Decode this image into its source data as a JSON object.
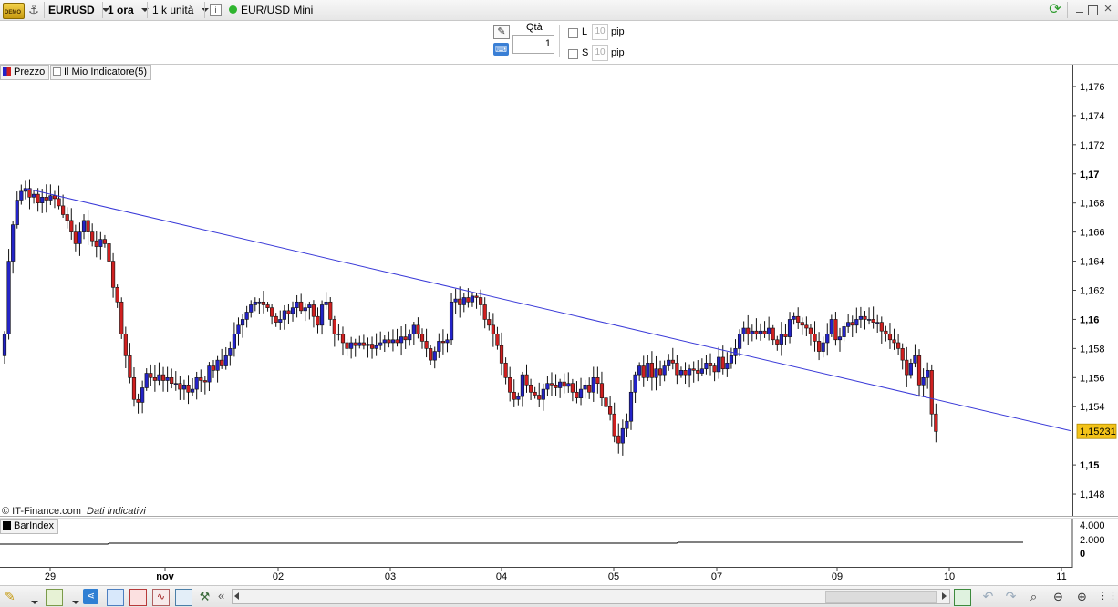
{
  "toolbar": {
    "demo_badge": "DEMO",
    "symbol": "EURUSD",
    "timeframe": "1 ora",
    "units": "1 k unità",
    "instrument_name": "EUR/USD Mini",
    "status_color": "#2fb52f"
  },
  "order_panel": {
    "qty_label": "Qtà",
    "qty_value": "1",
    "limit_label": "L",
    "limit_value": "10",
    "limit_unit": "pip",
    "stop_label": "S",
    "stop_value": "10",
    "stop_unit": "pip"
  },
  "legend": {
    "price_label": "Prezzo",
    "indicator_label": "Il Mio Indicatore(5)"
  },
  "copyright": {
    "source": "© IT-Finance.com",
    "note": "Dati indicativi"
  },
  "subpanel": {
    "label": "BarIndex",
    "ticks": [
      "4.000",
      "2.000",
      "0"
    ]
  },
  "chart_data": {
    "type": "candlestick",
    "instrument": "EURUSD",
    "timeframe": "1 ora",
    "y_ticks": [
      "1,176",
      "1,174",
      "1,172",
      "1,17",
      "1,168",
      "1,166",
      "1,164",
      "1,162",
      "1,16",
      "1,158",
      "1,156",
      "1,154",
      "1,15",
      "1,148"
    ],
    "ylim": [
      1.1465,
      1.1775
    ],
    "x_ticks": [
      "29",
      "nov",
      "02",
      "03",
      "04",
      "05",
      "07",
      "09",
      "10",
      "11"
    ],
    "current_price_label": "1,15231",
    "current_price": 1.15231,
    "trendline": {
      "from": 1.169,
      "to": 1.1531
    },
    "colors": {
      "up": "#2323c8",
      "down": "#d02020",
      "trendline": "#3a3ad8",
      "price_tag": "#f3c319"
    },
    "closes": [
      1.159,
      1.164,
      1.1665,
      1.1682,
      1.1688,
      1.169,
      1.1684,
      1.1686,
      1.168,
      1.1684,
      1.1682,
      1.1685,
      1.1683,
      1.1678,
      1.1672,
      1.1668,
      1.166,
      1.1652,
      1.166,
      1.1668,
      1.166,
      1.1654,
      1.165,
      1.1655,
      1.1652,
      1.164,
      1.1622,
      1.1612,
      1.159,
      1.1575,
      1.156,
      1.1545,
      1.1543,
      1.1553,
      1.1563,
      1.156,
      1.1558,
      1.1562,
      1.1558,
      1.156,
      1.1556,
      1.1556,
      1.1552,
      1.1555,
      1.155,
      1.1552,
      1.156,
      1.1558,
      1.1557,
      1.1568,
      1.1565,
      1.1572,
      1.1568,
      1.1575,
      1.158,
      1.159,
      1.1596,
      1.16,
      1.1605,
      1.161,
      1.1612,
      1.1612,
      1.161,
      1.1608,
      1.1602,
      1.1598,
      1.16,
      1.1606,
      1.1604,
      1.1608,
      1.1612,
      1.1606,
      1.1608,
      1.161,
      1.1602,
      1.1596,
      1.161,
      1.1612,
      1.16,
      1.159,
      1.159,
      1.1584,
      1.158,
      1.1584,
      1.1582,
      1.1584,
      1.1582,
      1.1583,
      1.158,
      1.1582,
      1.1584,
      1.1586,
      1.1584,
      1.1586,
      1.1584,
      1.1588,
      1.1586,
      1.159,
      1.1596,
      1.159,
      1.1585,
      1.158,
      1.1572,
      1.1578,
      1.1585,
      1.1584,
      1.1586,
      1.1612,
      1.1614,
      1.161,
      1.1615,
      1.1612,
      1.1616,
      1.1615,
      1.161,
      1.16,
      1.1596,
      1.159,
      1.1582,
      1.157,
      1.156,
      1.155,
      1.1545,
      1.1547,
      1.1562,
      1.1555,
      1.155,
      1.1548,
      1.1545,
      1.1552,
      1.1556,
      1.1555,
      1.1553,
      1.1557,
      1.1554,
      1.1556,
      1.155,
      1.1546,
      1.1552,
      1.1555,
      1.155,
      1.156,
      1.1556,
      1.1546,
      1.154,
      1.1535,
      1.152,
      1.1515,
      1.1525,
      1.153,
      1.155,
      1.1562,
      1.1568,
      1.156,
      1.157,
      1.156,
      1.1566,
      1.1562,
      1.1568,
      1.1572,
      1.157,
      1.1562,
      1.1565,
      1.1562,
      1.1566,
      1.1565,
      1.1563,
      1.1566,
      1.157,
      1.1568,
      1.1564,
      1.1574,
      1.1566,
      1.157,
      1.1575,
      1.158,
      1.159,
      1.1594,
      1.159,
      1.1592,
      1.159,
      1.1592,
      1.159,
      1.1594,
      1.1586,
      1.1583,
      1.159,
      1.1588,
      1.16,
      1.1602,
      1.1598,
      1.1596,
      1.1594,
      1.159,
      1.1585,
      1.1578,
      1.1584,
      1.159,
      1.16,
      1.1586,
      1.1588,
      1.1595,
      1.1598,
      1.1596,
      1.16,
      1.1602,
      1.16,
      1.16,
      1.1598,
      1.1598,
      1.1592,
      1.159,
      1.1586,
      1.1584,
      1.158,
      1.1572,
      1.1562,
      1.157,
      1.1575,
      1.1555,
      1.156,
      1.1565,
      1.1535,
      1.1523
    ]
  }
}
